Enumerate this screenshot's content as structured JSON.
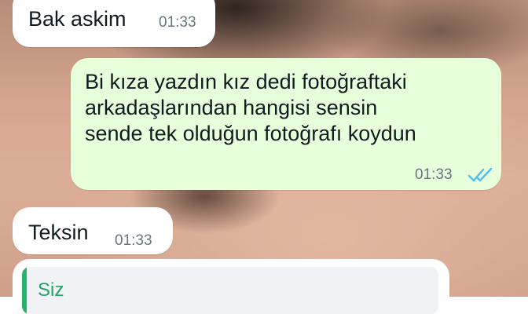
{
  "messages": [
    {
      "direction": "incoming",
      "text": "Bak askim",
      "time": "01:33"
    },
    {
      "direction": "outgoing",
      "lines": [
        "Bi kıza yazdın kız dedi fotoğraftaki",
        "arkadaşlarından hangisi sensin",
        "sende tek olduğun fotoğrafı koydun"
      ],
      "time": "01:33",
      "status_icon": "double-check-icon",
      "status_color": "#53bdeb"
    },
    {
      "direction": "incoming",
      "text": "Teksin",
      "time": "01:33"
    }
  ],
  "reply_preview": {
    "sender": "Siz",
    "accent_color": "#25b36d"
  },
  "colors": {
    "incoming_bubble": "#ffffff",
    "outgoing_bubble": "#e7ffdb",
    "text": "#111b21",
    "meta": "#667781"
  }
}
